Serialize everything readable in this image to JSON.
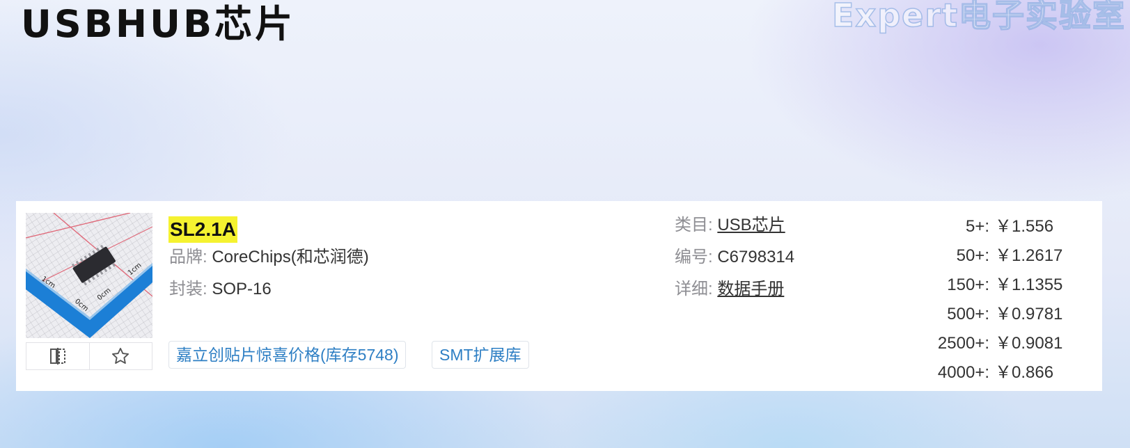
{
  "header": {
    "title": "USBHUB芯片",
    "watermark": "Expert电子实验室"
  },
  "product": {
    "part_number": "SL2.1A",
    "brand_label": "品牌:",
    "brand_value": "CoreChips(和芯润德)",
    "package_label": "封装:",
    "package_value": "SOP-16",
    "category_label": "类目:",
    "category_value": "USB芯片",
    "code_label": "编号:",
    "code_value": "C6798314",
    "detail_label": "详细:",
    "detail_value": "数据手册",
    "image_marks": [
      "1cm",
      "1cm",
      "0cm",
      "0cm"
    ],
    "tags": [
      "嘉立创贴片惊喜价格(库存5748)",
      "SMT扩展库"
    ],
    "actions": {
      "compare_icon": "compare-icon",
      "favorite_icon": "star-icon"
    },
    "prices": [
      {
        "qty": "5+:",
        "price": "￥1.556"
      },
      {
        "qty": "50+:",
        "price": "￥1.2617"
      },
      {
        "qty": "150+:",
        "price": "￥1.1355"
      },
      {
        "qty": "500+:",
        "price": "￥0.9781"
      },
      {
        "qty": "2500+:",
        "price": "￥0.9081"
      },
      {
        "qty": "4000+:",
        "price": "￥0.866"
      }
    ]
  }
}
